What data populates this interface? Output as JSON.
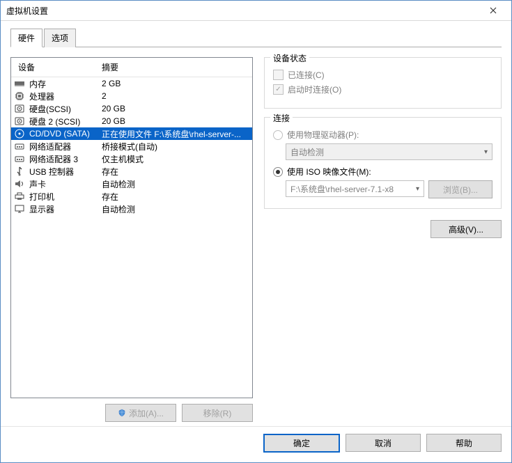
{
  "window": {
    "title": "虚拟机设置"
  },
  "tabs": {
    "hardware": "硬件",
    "options": "选项"
  },
  "list": {
    "col_device": "设备",
    "col_summary": "摘要",
    "rows": [
      {
        "name": "内存",
        "summary": "2 GB",
        "icon": "memory"
      },
      {
        "name": "处理器",
        "summary": "2",
        "icon": "cpu"
      },
      {
        "name": "硬盘(SCSI)",
        "summary": "20 GB",
        "icon": "disk"
      },
      {
        "name": "硬盘 2 (SCSI)",
        "summary": "20 GB",
        "icon": "disk"
      },
      {
        "name": "CD/DVD (SATA)",
        "summary": "正在使用文件 F:\\系统盘\\rhel-server-...",
        "icon": "cd",
        "selected": true
      },
      {
        "name": "网络适配器",
        "summary": "桥接模式(自动)",
        "icon": "net"
      },
      {
        "name": "网络适配器 3",
        "summary": "仅主机模式",
        "icon": "net"
      },
      {
        "name": "USB 控制器",
        "summary": "存在",
        "icon": "usb"
      },
      {
        "name": "声卡",
        "summary": "自动检测",
        "icon": "sound"
      },
      {
        "name": "打印机",
        "summary": "存在",
        "icon": "printer"
      },
      {
        "name": "显示器",
        "summary": "自动检测",
        "icon": "display"
      }
    ]
  },
  "buttons": {
    "add": "添加(A)...",
    "remove": "移除(R)"
  },
  "status_group": {
    "legend": "设备状态",
    "connected": "已连接(C)",
    "connect_at_poweron": "启动时连接(O)"
  },
  "connection_group": {
    "legend": "连接",
    "use_physical": "使用物理驱动器(P):",
    "physical_value": "自动检测",
    "use_iso": "使用 ISO 映像文件(M):",
    "iso_value": "F:\\系统盘\\rhel-server-7.1-x8",
    "browse": "浏览(B)..."
  },
  "advanced": "高级(V)...",
  "footer": {
    "ok": "确定",
    "cancel": "取消",
    "help": "帮助"
  }
}
